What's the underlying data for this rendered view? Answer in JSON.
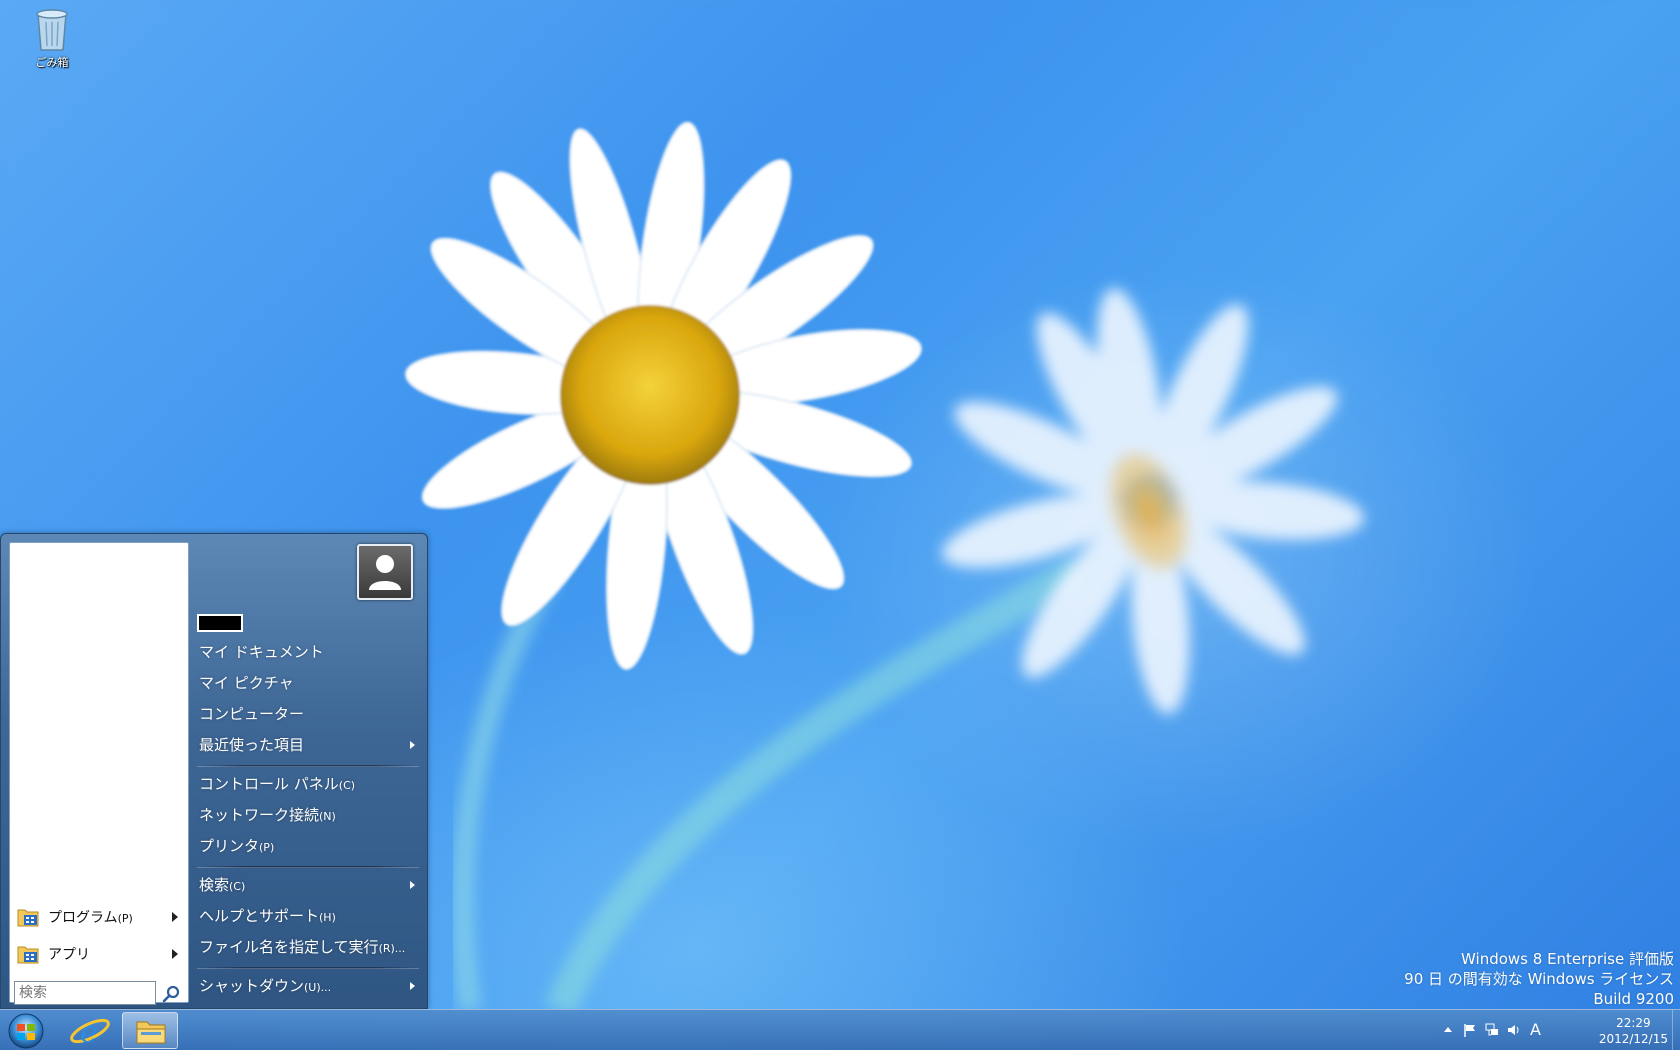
{
  "desktop": {
    "icons": [
      {
        "label": "ごみ箱",
        "icon": "recycle-bin-icon"
      }
    ],
    "watermark": {
      "line1": "Windows 8 Enterprise 評価版",
      "line2": "90 日 の間有効な Windows ライセンス",
      "line3": "Build 9200"
    }
  },
  "start_menu": {
    "left": {
      "programs_label": "プログラム",
      "programs_accel": "(P)",
      "apps_label": "アプリ",
      "search_placeholder": "検索"
    },
    "right": {
      "items": [
        {
          "label": "マイ ドキュメント",
          "accel": ""
        },
        {
          "label": "マイ ピクチャ",
          "accel": ""
        },
        {
          "label": "コンピューター",
          "accel": ""
        },
        {
          "label": "最近使った項目",
          "accel": ""
        },
        {
          "label": "コントロール パネル",
          "accel": "(C)"
        },
        {
          "label": "ネットワーク接続",
          "accel": "(N)"
        },
        {
          "label": "プリンタ",
          "accel": "(P)"
        },
        {
          "label": "検索",
          "accel": "(C)"
        },
        {
          "label": "ヘルプとサポート",
          "accel": "(H)"
        },
        {
          "label": "ファイル名を指定して実行",
          "accel": "(R)..."
        },
        {
          "label": "シャットダウン",
          "accel": "(U)..."
        }
      ]
    }
  },
  "taskbar": {
    "pinned": [
      "start-orb-icon",
      "internet-explorer-icon",
      "file-explorer-icon"
    ],
    "tray": {
      "ime_indicator": "A",
      "time": "22:29",
      "date": "2012/12/15"
    }
  }
}
